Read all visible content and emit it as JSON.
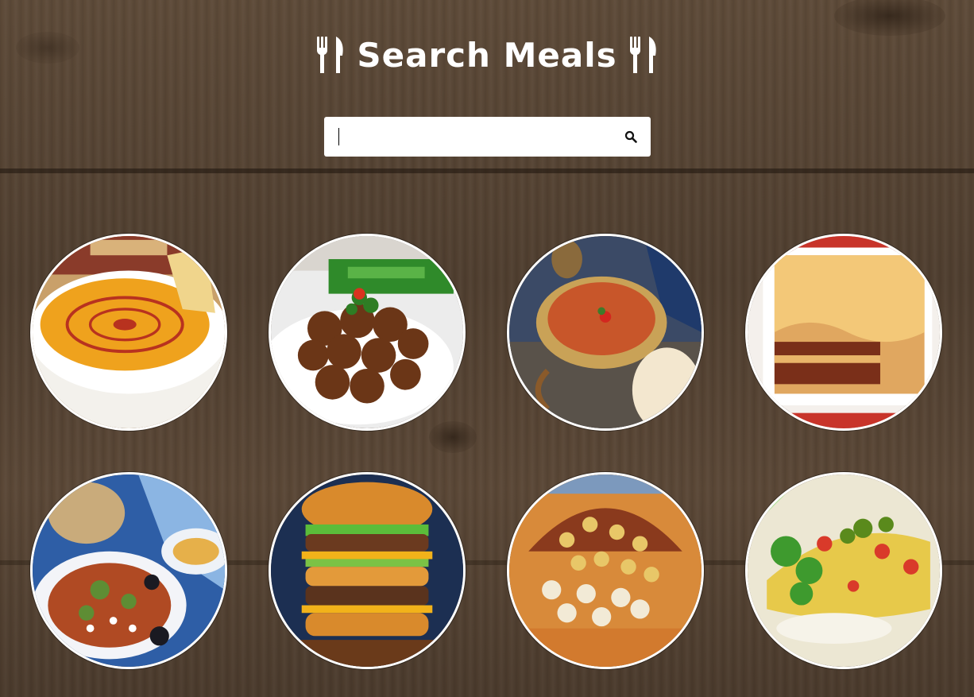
{
  "header": {
    "title": "Search Meals",
    "icon": "fork-knife-icon"
  },
  "search": {
    "value": "",
    "placeholder": "",
    "button_icon": "search-icon"
  },
  "meals": [
    {
      "name": "lentil-soup"
    },
    {
      "name": "falafel"
    },
    {
      "name": "red-soup"
    },
    {
      "name": "lasagna"
    },
    {
      "name": "vegetable-salad"
    },
    {
      "name": "double-cheeseburger"
    },
    {
      "name": "koshari"
    },
    {
      "name": "loaded-nachos"
    }
  ],
  "colors": {
    "background": "#4f3e2f",
    "title": "#ffffff",
    "search_bg": "#ffffff"
  }
}
